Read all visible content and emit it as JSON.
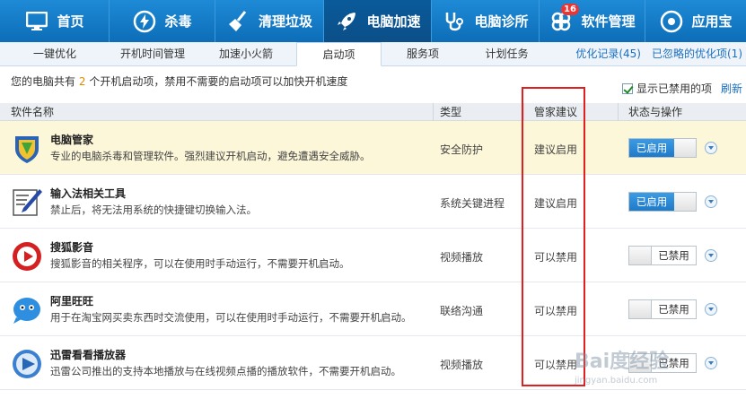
{
  "nav": {
    "items": [
      {
        "label": "首页",
        "icon": "monitor-icon"
      },
      {
        "label": "杀毒",
        "icon": "lightning-icon"
      },
      {
        "label": "清理垃圾",
        "icon": "broom-icon"
      },
      {
        "label": "电脑加速",
        "icon": "rocket-icon",
        "active": true
      },
      {
        "label": "电脑诊所",
        "icon": "stethoscope-icon"
      },
      {
        "label": "软件管理",
        "icon": "software-icon",
        "badge": "16"
      },
      {
        "label": "应用宝",
        "icon": "app-store-icon"
      }
    ]
  },
  "subtabs": {
    "items": [
      "一键优化",
      "开机时间管理",
      "加速小火箭",
      "启动项",
      "服务项",
      "计划任务"
    ],
    "active": "启动项",
    "links": [
      "优化记录(45)",
      "已忽略的优化项(1)"
    ]
  },
  "info": {
    "prefix": "您的电脑共有",
    "count": "2",
    "suffix": "个开机启动项，禁用不需要的启动项可以加快开机速度",
    "show_disabled": "显示已禁用的项",
    "refresh": "刷新"
  },
  "table": {
    "headers": {
      "name": "软件名称",
      "type": "类型",
      "advice": "管家建议",
      "status": "状态与操作"
    },
    "rows": [
      {
        "name": "电脑管家",
        "desc": "专业的电脑杀毒和管理软件。强烈建议开机启动，避免遭遇安全威胁。",
        "type": "安全防护",
        "advice": "建议启用",
        "status": "已启用",
        "icon": "shield-icon"
      },
      {
        "name": "输入法相关工具",
        "desc": "禁止后，将无法用系统的快捷键切换输入法。",
        "type": "系统关键进程",
        "advice": "建议启用",
        "status": "已启用",
        "icon": "pen-document-icon"
      },
      {
        "name": "搜狐影音",
        "desc": "搜狐影音的相关程序，可以在使用时手动运行，不需要开机启动。",
        "type": "视频播放",
        "advice": "可以禁用",
        "status": "已禁用",
        "icon": "play-icon"
      },
      {
        "name": "阿里旺旺",
        "desc": "用于在淘宝网买卖东西时交流使用，可以在使用时手动运行，不需要开机启动。",
        "type": "联络沟通",
        "advice": "可以禁用",
        "status": "已禁用",
        "icon": "chat-bubble-icon"
      },
      {
        "name": "迅雷看看播放器",
        "desc": "迅雷公司推出的支持本地播放与在线视频点播的播放软件，不需要开机启动。",
        "type": "视频播放",
        "advice": "可以禁用",
        "status": "已禁用",
        "icon": "player-icon"
      }
    ]
  },
  "watermark": {
    "main": "Bai度经验",
    "sub": "jingyan.baidu.com"
  },
  "colors": {
    "nav_bg": "#0d6db8",
    "enabled": "#1f7ac8",
    "highlight_row": "#fdf7d9",
    "annotation": "#e02020"
  }
}
